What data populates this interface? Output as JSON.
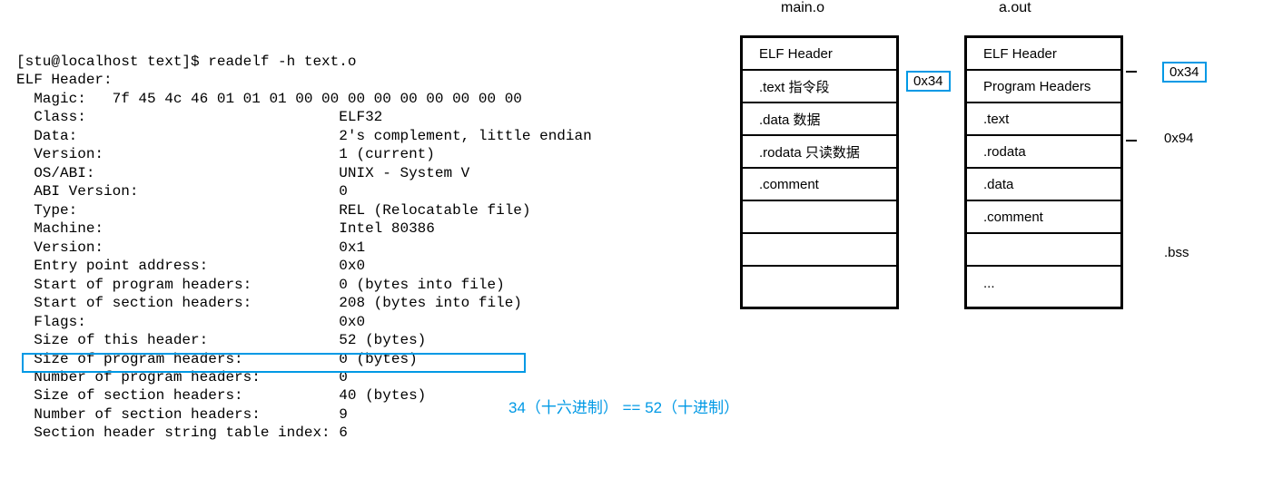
{
  "terminal": {
    "prompt": "[stu@localhost text]$ readelf -h text.o",
    "header": "ELF Header:",
    "magic": "  Magic:   7f 45 4c 46 01 01 01 00 00 00 00 00 00 00 00 00",
    "class": "  Class:                             ELF32",
    "data": "  Data:                              2's complement, little endian",
    "version1": "  Version:                           1 (current)",
    "osabi": "  OS/ABI:                            UNIX - System V",
    "abiver": "  ABI Version:                       0",
    "type": "  Type:                              REL (Relocatable file)",
    "machine": "  Machine:                           Intel 80386",
    "version2": "  Version:                           0x1",
    "entry": "  Entry point address:               0x0",
    "startph": "  Start of program headers:          0 (bytes into file)",
    "startsh": "  Start of section headers:          208 (bytes into file)",
    "flags": "  Flags:                             0x0",
    "sizehdr": "  Size of this header:               52 (bytes)",
    "sizeph": "  Size of program headers:           0 (bytes)",
    "numph": "  Number of program headers:         0",
    "sizesh": "  Size of section headers:           40 (bytes)",
    "numsh": "  Number of section headers:         9",
    "shstrndx": "  Section header string table index: 6"
  },
  "annotation": "34（十六进制） == 52（十进制）",
  "diagram": {
    "main_title": "main.o",
    "aout_title": "a.out",
    "main_rows": [
      "ELF Header",
      ".text 指令段",
      ".data  数据",
      ".rodata 只读数据",
      ".comment",
      "",
      "",
      ""
    ],
    "aout_rows": [
      "ELF Header",
      "Program Headers",
      ".text",
      ".rodata",
      ".data",
      ".comment",
      "",
      "..."
    ],
    "offset34": "0x34",
    "offset94": "0x94",
    "bss": ".bss"
  }
}
